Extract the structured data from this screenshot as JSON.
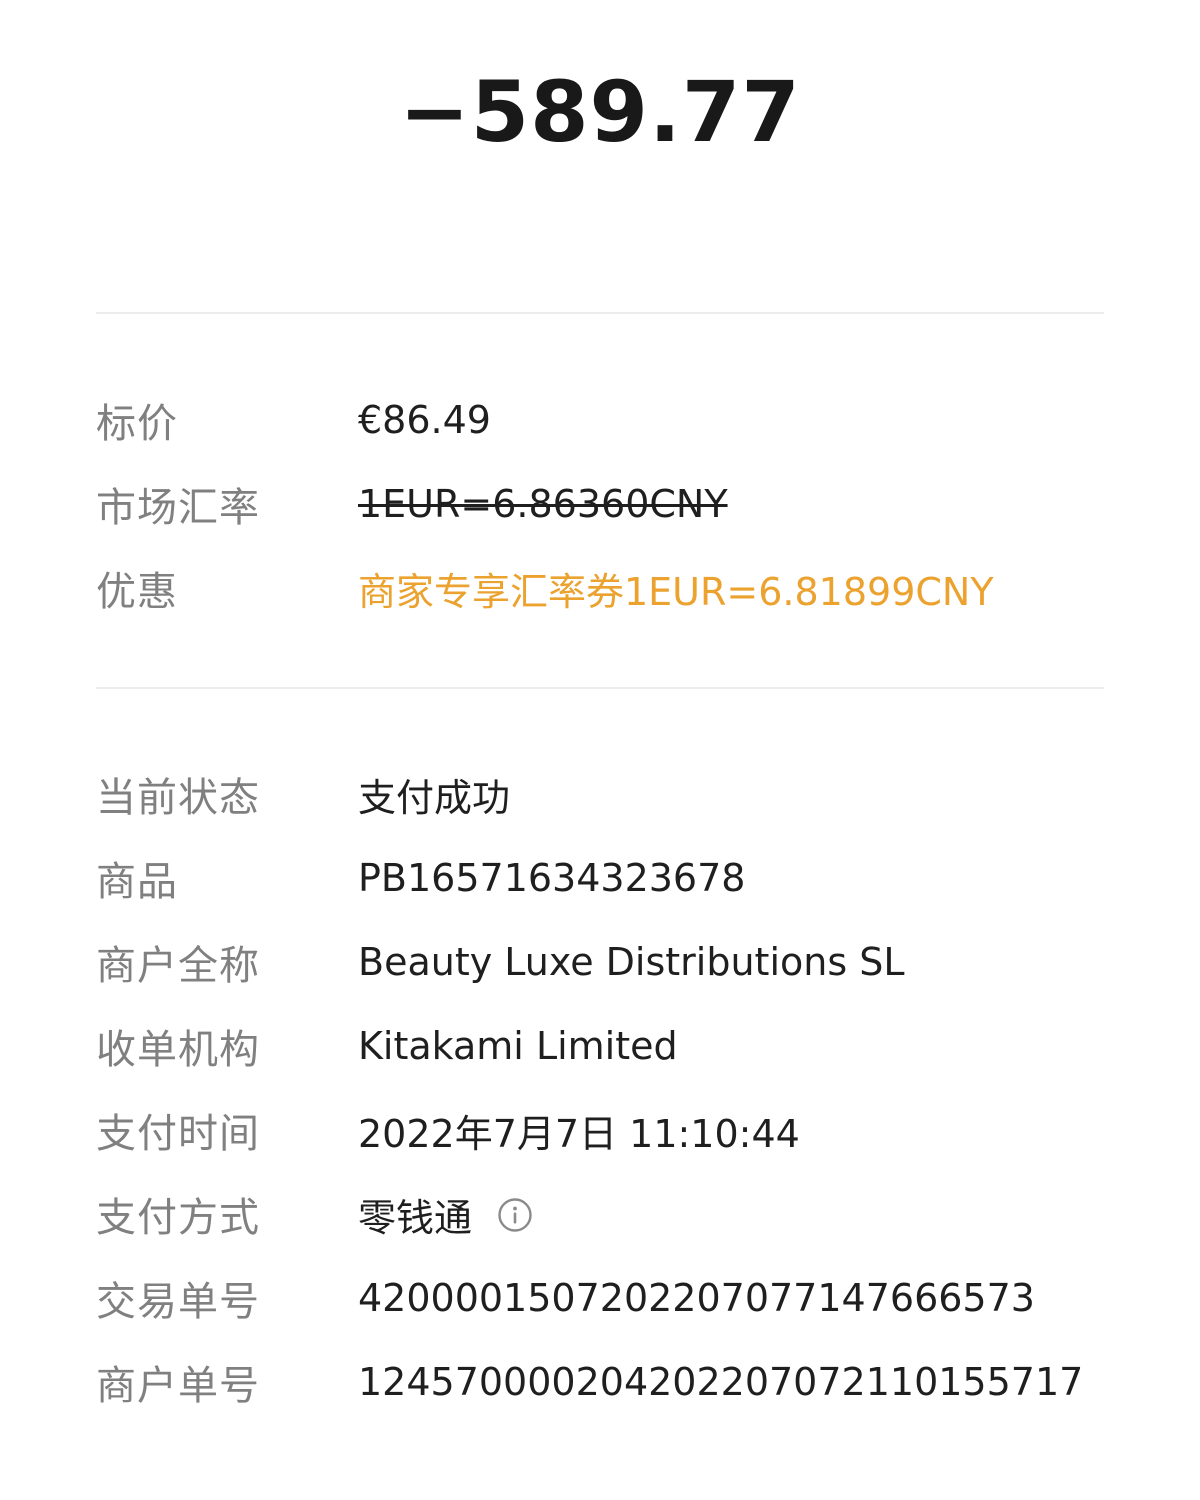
{
  "amount": "−589.77",
  "pricing": [
    {
      "label": "标价",
      "value": "€86.49"
    },
    {
      "label": "市场汇率",
      "value": "1EUR=6.86360CNY"
    },
    {
      "label": "优惠",
      "value": "商家专享汇率券1EUR=6.81899CNY"
    }
  ],
  "details": {
    "status": {
      "label": "当前状态",
      "value": "支付成功"
    },
    "product": {
      "label": "商品",
      "value": "PB16571634323678"
    },
    "merchant_name": {
      "label": "商户全称",
      "value": "Beauty Luxe Distributions SL"
    },
    "acquirer": {
      "label": "收单机构",
      "value": "Kitakami Limited"
    },
    "pay_time": {
      "label": "支付时间",
      "value": "2022年7月7日 11:10:44"
    },
    "pay_method": {
      "label": "支付方式",
      "value": "零钱通",
      "icon": "info-icon"
    },
    "transaction_no": {
      "label": "交易单号",
      "value": "4200001507202207077147666573"
    },
    "merchant_order_no": {
      "label": "商户单号",
      "value": "124570000204202207072110155717"
    }
  },
  "colors": {
    "accent": "#eba22f",
    "label": "#808080",
    "text": "#1f1f1f",
    "divider": "#ededed"
  }
}
